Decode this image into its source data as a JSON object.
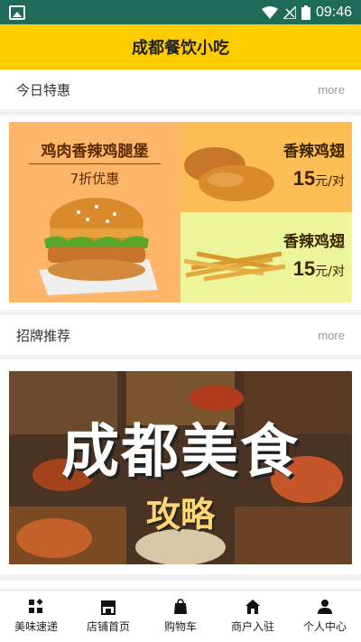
{
  "status_bar": {
    "time": "09:46"
  },
  "app_title": "成都餐饮小吃",
  "sections": {
    "today": {
      "label": "今日特惠",
      "more": "more"
    },
    "signature": {
      "label": "招牌推荐",
      "more": "more"
    }
  },
  "promo": {
    "main": {
      "title": "鸡肉香辣鸡腿堡",
      "discount": "7折优惠"
    },
    "items": [
      {
        "name": "香辣鸡翅",
        "price": "15",
        "unit": "元/对"
      },
      {
        "name": "香辣鸡翅",
        "price": "15",
        "unit": "元/对"
      }
    ]
  },
  "banner": {
    "title": "成都美食",
    "subtitle": "攻略"
  },
  "bottom_nav": [
    {
      "label": "美味速递",
      "icon": "grid-icon"
    },
    {
      "label": "店铺首页",
      "icon": "store-icon"
    },
    {
      "label": "购物车",
      "icon": "bag-icon"
    },
    {
      "label": "商户入驻",
      "icon": "home-icon"
    },
    {
      "label": "个人中心",
      "icon": "person-icon"
    }
  ]
}
